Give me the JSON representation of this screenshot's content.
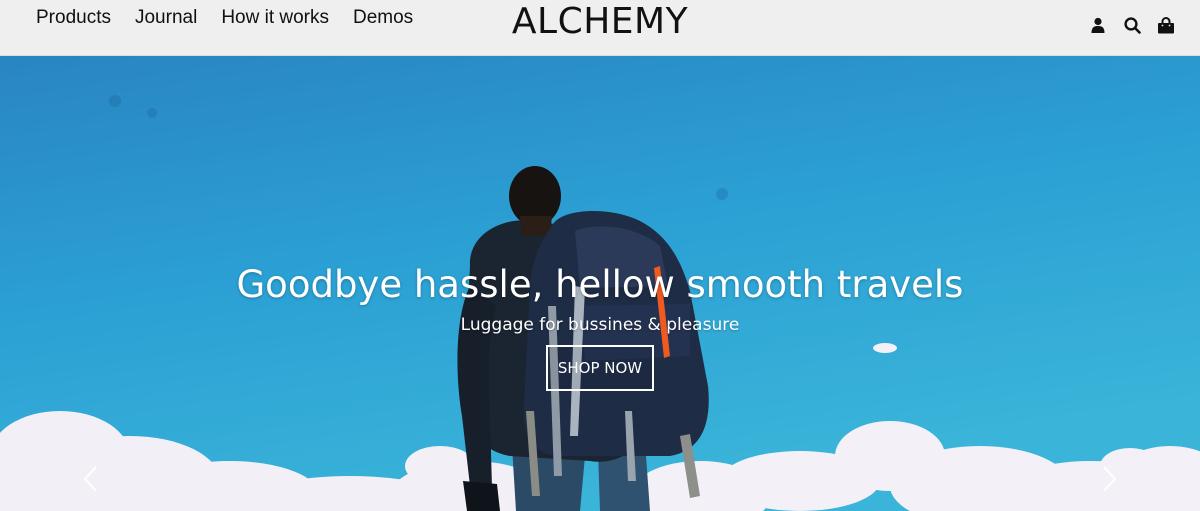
{
  "header": {
    "nav": [
      {
        "label": "Products"
      },
      {
        "label": "Journal"
      },
      {
        "label": "How it works"
      },
      {
        "label": "Demos"
      }
    ],
    "logo": "ALCHEMY",
    "icons": [
      "user-icon",
      "search-icon",
      "shopping-bag-icon"
    ]
  },
  "hero": {
    "title": "Goodbye hassle, hellow smooth travels",
    "subtitle": "Luggage for bussines & pleasure",
    "cta_label": "SHOP NOW",
    "arrows": [
      "chevron-left-icon",
      "chevron-right-icon"
    ]
  },
  "colors": {
    "header_bg": "#efefef",
    "sky": "#2a9fd4",
    "text": "#111111",
    "hero_text": "#ffffff"
  }
}
